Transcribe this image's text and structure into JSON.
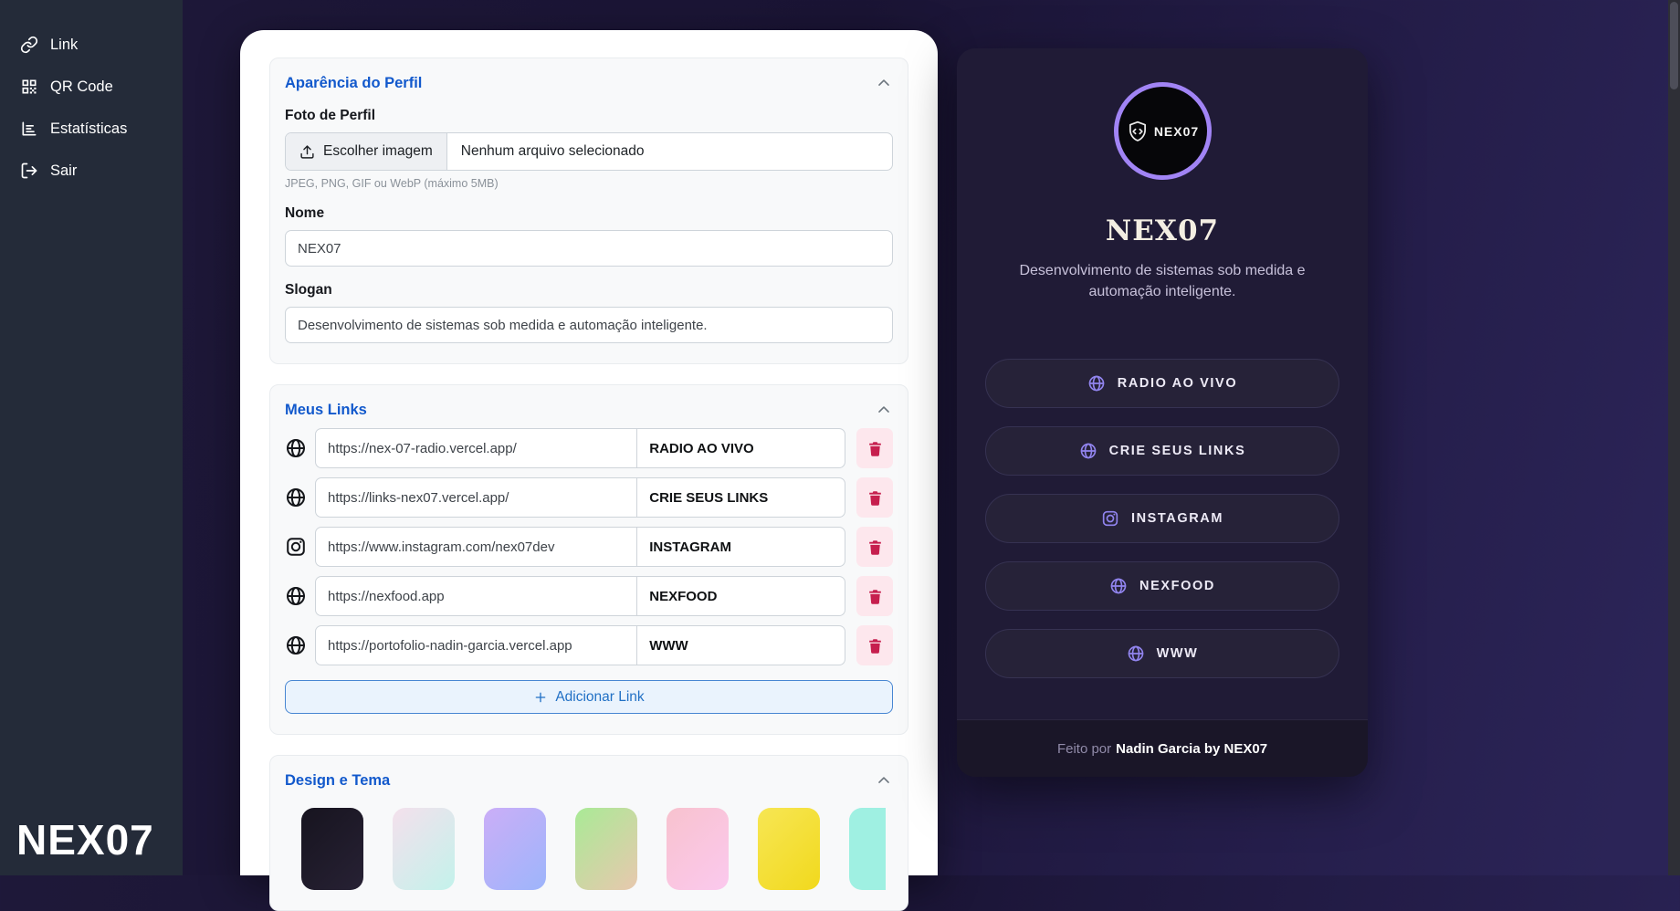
{
  "sidebar": {
    "logo": "NEX07",
    "items": [
      {
        "label": "Link",
        "icon": "link-icon"
      },
      {
        "label": "QR Code",
        "icon": "qr-code-icon"
      },
      {
        "label": "Estatísticas",
        "icon": "stats-icon"
      },
      {
        "label": "Sair",
        "icon": "logout-icon"
      }
    ]
  },
  "profile_card": {
    "title": "Aparência do Perfil",
    "photo_label": "Foto de Perfil",
    "choose_image_label": "Escolher imagem",
    "no_file_label": "Nenhum arquivo selecionado",
    "file_hint": "JPEG, PNG, GIF ou WebP (máximo 5MB)",
    "name_label": "Nome",
    "name_value": "NEX07",
    "slogan_label": "Slogan",
    "slogan_value": "Desenvolvimento de sistemas sob medida e automação inteligente."
  },
  "links_card": {
    "title": "Meus Links",
    "add_label": "Adicionar Link",
    "links": [
      {
        "icon": "globe-icon",
        "url": "https://nex-07-radio.vercel.app/",
        "title": "RADIO AO VIVO"
      },
      {
        "icon": "globe-icon",
        "url": "https://links-nex07.vercel.app/",
        "title": "CRIE SEUS LINKS"
      },
      {
        "icon": "instagram-icon",
        "url": "https://www.instagram.com/nex07dev",
        "title": "INSTAGRAM"
      },
      {
        "icon": "globe-icon",
        "url": "https://nexfood.app",
        "title": "NEXFOOD"
      },
      {
        "icon": "globe-icon",
        "url": "https://portofolio-nadin-garcia.vercel.app",
        "title": "WWW"
      }
    ]
  },
  "design_card": {
    "title": "Design e Tema",
    "swatches": [
      {
        "name": "dark",
        "colors": [
          "#17141f",
          "#272134"
        ]
      },
      {
        "name": "pink-cyan",
        "colors": [
          "#f4e0ec",
          "#c3f2eb"
        ]
      },
      {
        "name": "lavender-blue",
        "colors": [
          "#cbaef7",
          "#9db5fb"
        ]
      },
      {
        "name": "green-peach",
        "colors": [
          "#a9ea96",
          "#e8c8ae"
        ]
      },
      {
        "name": "soft-pink",
        "colors": [
          "#f8c2ce",
          "#fbc9ee"
        ]
      },
      {
        "name": "yellow",
        "colors": [
          "#f7e654",
          "#f1d91d"
        ]
      },
      {
        "name": "mint",
        "colors": [
          "#9ff0e2",
          "#9ff0e2"
        ]
      }
    ]
  },
  "preview": {
    "avatar_text": "NEX07",
    "name": "NEX07",
    "slogan": "Desenvolvimento de sistemas sob medida e automação inteligente.",
    "buttons": [
      {
        "icon": "globe-icon",
        "label": "RADIO AO VIVO"
      },
      {
        "icon": "globe-icon",
        "label": "CRIE SEUS LINKS"
      },
      {
        "icon": "instagram-icon",
        "label": "INSTAGRAM"
      },
      {
        "icon": "globe-icon",
        "label": "NEXFOOD"
      },
      {
        "icon": "globe-icon",
        "label": "WWW"
      }
    ],
    "footer_prefix": "Feito por",
    "footer_bold": "Nadin Garcia by NEX07"
  },
  "colors": {
    "accent_blue": "#1259cc",
    "accent_purple": "#a184f5",
    "danger_red": "#c61f4e",
    "sidebar_bg": "#242b39",
    "preview_bg": "#201b36"
  }
}
